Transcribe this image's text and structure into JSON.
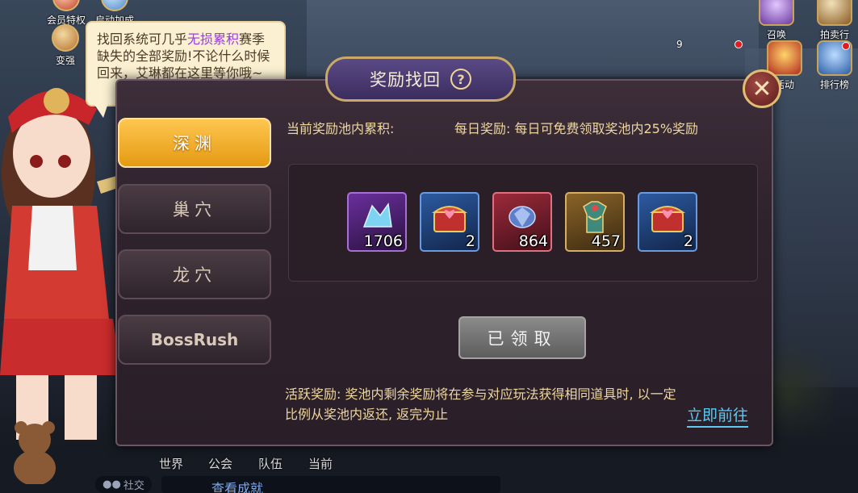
{
  "hud_top_left": [
    {
      "label": "会员特权",
      "icon": "vip-crown-icon"
    },
    {
      "label": "启动加成",
      "icon": "launch-bonus-icon"
    },
    {
      "label": "变强",
      "icon": "power-up-icon"
    }
  ],
  "hud_top_right": [
    {
      "label": "召唤",
      "icon": "summon-icon"
    },
    {
      "label": "拍卖行",
      "icon": "auction-house-icon"
    },
    {
      "label": "活动",
      "icon": "events-icon"
    },
    {
      "label": "排行榜",
      "icon": "leaderboard-icon"
    }
  ],
  "hud_badge_count": "9",
  "bubble": {
    "text_before": "找回系统可几乎",
    "highlight": "无损累积",
    "text_after": "赛季缺失的全部奖励!不论什么时候回来，艾琳都在这里等你哦~"
  },
  "dialog": {
    "title": "奖励找回",
    "help_glyph": "?",
    "close_glyph": "✕"
  },
  "tabs": [
    {
      "label": "深渊",
      "active": true
    },
    {
      "label": "巢穴",
      "active": false
    },
    {
      "label": "龙穴",
      "active": false
    },
    {
      "label": "BossRush",
      "active": false
    }
  ],
  "pool_label": "当前奖励池内累积:",
  "daily_reward": "每日奖励: 每日可免费领取奖池内25%奖励",
  "items": [
    {
      "name": "crystal-shard-icon",
      "rarity": "purple",
      "qty": "1706"
    },
    {
      "name": "treasure-chest-icon",
      "rarity": "blue",
      "qty": "2"
    },
    {
      "name": "crimson-crystal-icon",
      "rarity": "red",
      "qty": "864"
    },
    {
      "name": "costume-gift-icon",
      "rarity": "gold",
      "qty": "457"
    },
    {
      "name": "treasure-chest-icon",
      "rarity": "blue",
      "qty": "2"
    }
  ],
  "claim_button": "已领取",
  "active_reward": "活跃奖励: 奖池内剩余奖励将在参与对应玩法获得相同道具时, 以一定比例从奖池内返还, 返完为止",
  "go_link": "立即前往",
  "chat_tabs": [
    "世界",
    "公会",
    "队伍",
    "当前"
  ],
  "social_label": "社交",
  "chat_message": "查看成就",
  "colors": {
    "accent_gold": "#e49a12",
    "link_blue": "#5fc8f0",
    "text_gold": "#f0d79c",
    "highlight_purple": "#9a3be0"
  }
}
